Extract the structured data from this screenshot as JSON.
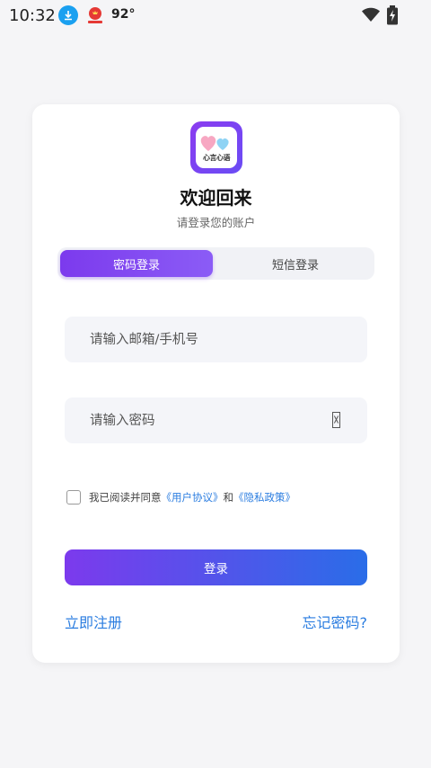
{
  "status_bar": {
    "time": "10:32",
    "temperature": "92°"
  },
  "card": {
    "title": "欢迎回来",
    "subtitle": "请登录您的账户",
    "logo_text": "心言心语",
    "tabs": [
      {
        "label": "密码登录",
        "active": true
      },
      {
        "label": "短信登录",
        "active": false
      }
    ],
    "account_field": {
      "placeholder": "请输入邮箱/手机号",
      "value": ""
    },
    "password_field": {
      "placeholder": "请输入密码",
      "value": ""
    },
    "agreement": {
      "prefix": "我已阅读并同意",
      "user_agreement": "《用户协议》",
      "and": "和",
      "privacy_policy": "《隐私政策》",
      "checked": false
    },
    "login_button": "登录",
    "register_link": "立即注册",
    "forgot_link": "忘记密码?"
  },
  "colors": {
    "accent_purple": "#7c3aed",
    "accent_blue": "#2a6de8",
    "link": "#2b7de0"
  }
}
